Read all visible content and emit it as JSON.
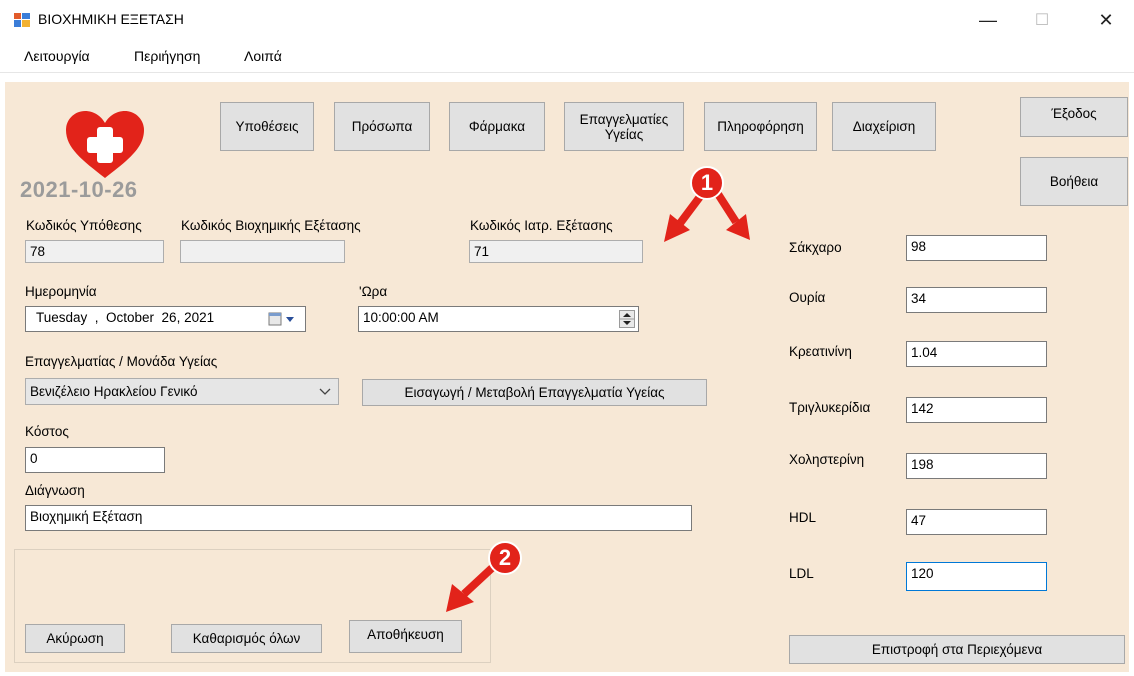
{
  "window": {
    "title": "ΒΙΟΧΗΜΙΚΗ ΕΞΕΤΑΣΗ",
    "minimize": "—",
    "maximize": "☐",
    "close": "✕"
  },
  "menu": [
    "Λειτουργία",
    "Περιήγηση",
    "Λοιπά"
  ],
  "header": {
    "date": "2021-10-26",
    "nav_buttons": [
      "Υποθέσεις",
      "Πρόσωπα",
      "Φάρμακα",
      "Επαγγελματίες Υγείας",
      "Πληροφόρηση",
      "Διαχείριση"
    ],
    "exit_label": "Έξοδος",
    "help_label": "Βοήθεια"
  },
  "form": {
    "case_code_label": "Κωδικός Υπόθεσης",
    "case_code_value": "78",
    "biochem_code_label": "Κωδικός Βιοχημικής Εξέτασης",
    "biochem_code_value": "",
    "med_exam_code_label": "Κωδικός Ιατρ. Εξέτασης",
    "med_exam_code_value": "71",
    "date_label": "Ημερομηνία",
    "date_value": "Tuesday  ,  October  26, 2021",
    "time_label": "'Ωρα",
    "time_value": "10:00:00 AM",
    "professional_label": "Επαγγελματίας / Μονάδα Υγείας",
    "professional_value": "Βενιζέλειο Ηρακλείου Γενικό",
    "professional_button": "Εισαγωγή / Μεταβολή Επαγγελματία Υγείας",
    "cost_label": "Κόστος",
    "cost_value": "0",
    "diagnosis_label": "Διάγνωση",
    "diagnosis_value": "Βιοχημική Εξέταση"
  },
  "actions": {
    "cancel": "Ακύρωση",
    "clear_all": "Καθαρισμός όλων",
    "save": "Αποθήκευση"
  },
  "results": [
    {
      "label": "Σάκχαρο",
      "value": "98"
    },
    {
      "label": "Ουρία",
      "value": "34"
    },
    {
      "label": "Κρεατινίνη",
      "value": "1.04"
    },
    {
      "label": "Τριγλυκερίδια",
      "value": "142"
    },
    {
      "label": "Χοληστερίνη",
      "value": "198"
    },
    {
      "label": "HDL",
      "value": "47"
    },
    {
      "label": "LDL",
      "value": "120"
    }
  ],
  "return_button": "Επιστροφή στα Περιεχόμενα",
  "annotations": {
    "badge1": "1",
    "badge2": "2"
  },
  "colors": {
    "background": "#f7e8d6",
    "accent_red": "#e2231a",
    "focus_border": "#0078d7"
  }
}
